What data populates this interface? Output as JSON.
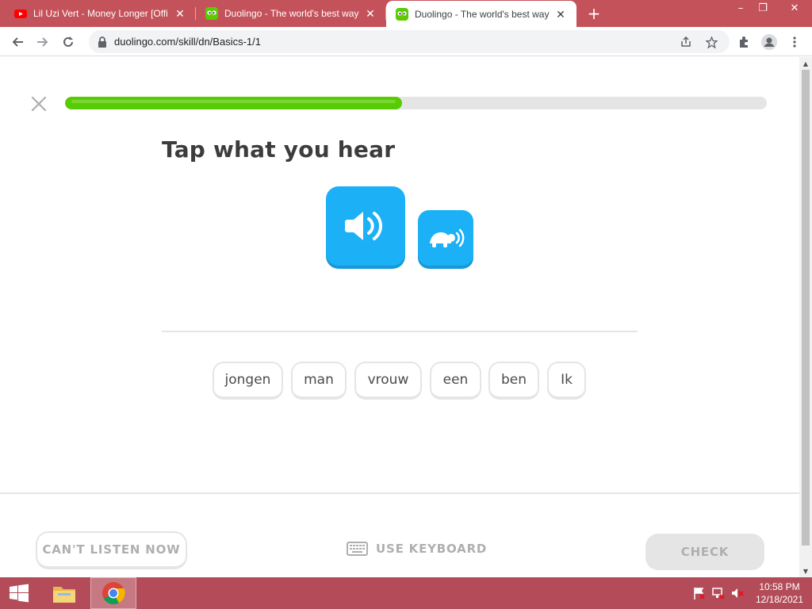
{
  "browser": {
    "tabs": [
      {
        "title": "Lil Uzi Vert - Money Longer [Offi",
        "icon": "youtube-icon",
        "active": false
      },
      {
        "title": "Duolingo - The world's best way",
        "icon": "duolingo-icon",
        "active": false
      },
      {
        "title": "Duolingo - The world's best way",
        "icon": "duolingo-icon",
        "active": true
      }
    ],
    "url": "duolingo.com/skill/dn/Basics-1/1"
  },
  "lesson": {
    "progress_percent": 48,
    "prompt": "Tap what you hear",
    "word_bank": [
      "jongen",
      "man",
      "vrouw",
      "een",
      "ben",
      "Ik"
    ]
  },
  "footer": {
    "cant_listen_label": "CAN'T LISTEN NOW",
    "keyboard_label": "USE KEYBOARD",
    "check_label": "CHECK"
  },
  "taskbar": {
    "time": "10:58 PM",
    "date": "12/18/2021"
  },
  "colors": {
    "tab_bar": "#c4525a",
    "progress_fill": "#58cc02",
    "audio_button": "#1cb0f6",
    "taskbar": "#b34c58"
  }
}
